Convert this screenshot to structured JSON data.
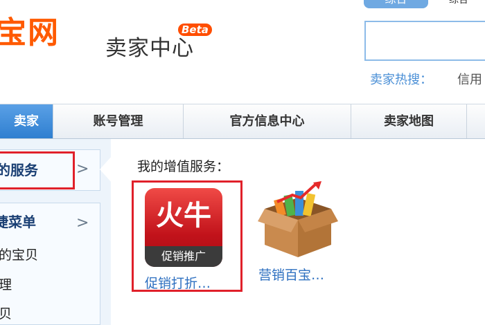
{
  "header": {
    "logo_text": "宝网",
    "logo_subtitle": "卖家中心",
    "beta_badge": "Beta",
    "search_tab_label": "综合",
    "top_right_link": "综合",
    "hot_search_label": "卖家热搜：",
    "hot_search_item": "信用"
  },
  "nav": {
    "items": [
      {
        "label": "卖家"
      },
      {
        "label": "账号管理"
      },
      {
        "label": "官方信息中心"
      },
      {
        "label": "卖家地图"
      },
      {
        "label": ""
      }
    ]
  },
  "sidebar": {
    "services_label": "的服务",
    "arrow": ">",
    "quick_menu_label": "捷菜单",
    "links": [
      "的宝贝",
      "理",
      "贝"
    ]
  },
  "main": {
    "title": "我的增值服务：",
    "services": [
      {
        "icon": "huoniu-promotion-icon",
        "icon_text": "火牛",
        "icon_band": "促销推广",
        "label": "促销打折…"
      },
      {
        "icon": "marketing-box-icon",
        "label": "营销百宝…"
      }
    ]
  },
  "colors": {
    "brand": "#ff5a00",
    "nav_active": "#3a88d8",
    "highlight_border": "#e0202a",
    "link": "#2d6fc0"
  }
}
